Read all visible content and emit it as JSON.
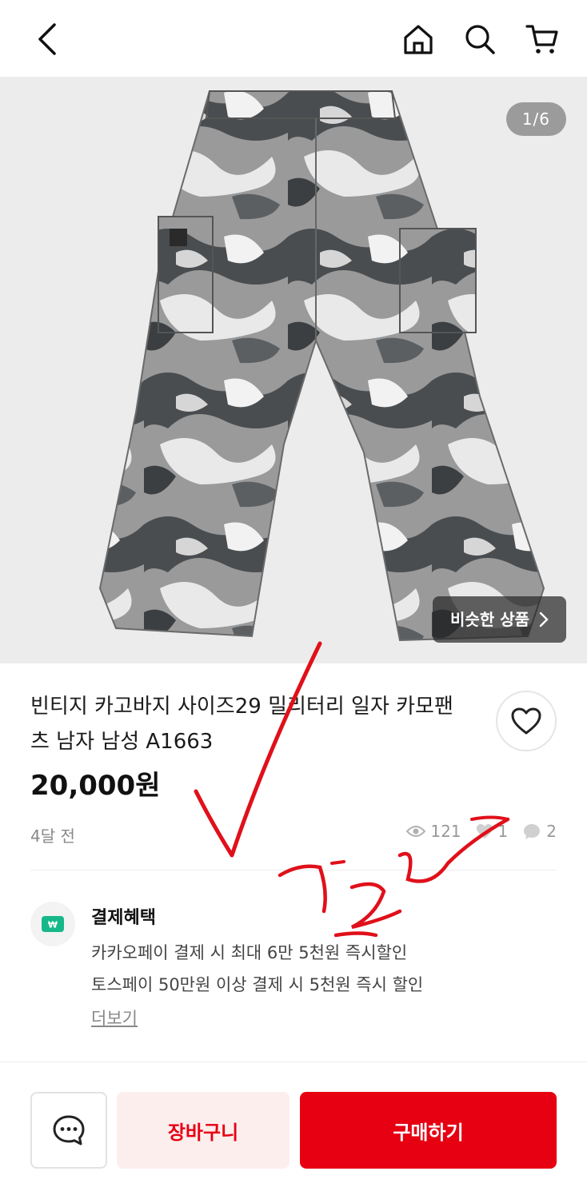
{
  "header": {
    "icons": [
      "back-arrow-icon",
      "home-icon",
      "search-icon",
      "cart-icon"
    ]
  },
  "gallery": {
    "counter": "1/6",
    "similar_label": "비슷한 상품",
    "similar_icon": "chevron-right-icon"
  },
  "product": {
    "title": "빈티지 카고바지 사이즈29 밀리터리 일자 카모팬츠 남자 남성 A1663",
    "price": "20,000원",
    "posted": "4달 전",
    "views": "121",
    "likes": "1",
    "chats": "2"
  },
  "benefits": {
    "title": "결제혜택",
    "line1": "카카오페이 결제 시 최대 6만 5천원 즉시할인",
    "line2": "토스페이 50만원 이상 결제 시 5천원 즉시 할인",
    "more": "더보기"
  },
  "actions": {
    "cart_label": "장바구니",
    "buy_label": "구매하기"
  },
  "colors": {
    "accent": "#e60012",
    "accent_light": "#fdeeee"
  }
}
